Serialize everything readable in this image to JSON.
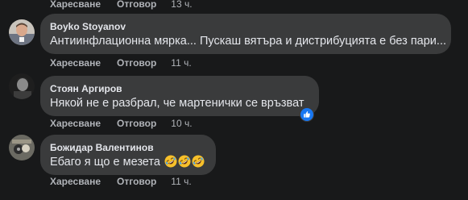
{
  "actions": {
    "like_label": "Харесване",
    "reply_label": "Отговор"
  },
  "comments": [
    {
      "time": "13 ч."
    },
    {
      "author": "Boyko Stoyanov",
      "text": "Антиинфлационна мярка... Пускаш вятъра и дистрибуцията е без пари...",
      "time": "11 ч."
    },
    {
      "author": "Стоян Аргиров",
      "text": "Някой не е разбрал, че мартенички се връзват",
      "time": "10 ч.",
      "reaction": "like-icon"
    },
    {
      "author": "Божидар Валентинов",
      "text": "Ебаго я що е мезета",
      "emoji": "rolling-on-floor-laughing-emoji",
      "emoji_count": 3,
      "time": "11 ч."
    }
  ],
  "colors": {
    "background": "#18191a",
    "bubble": "#3a3b3c",
    "action_text": "#b0b3b8",
    "like_blue": "#1877f2"
  }
}
